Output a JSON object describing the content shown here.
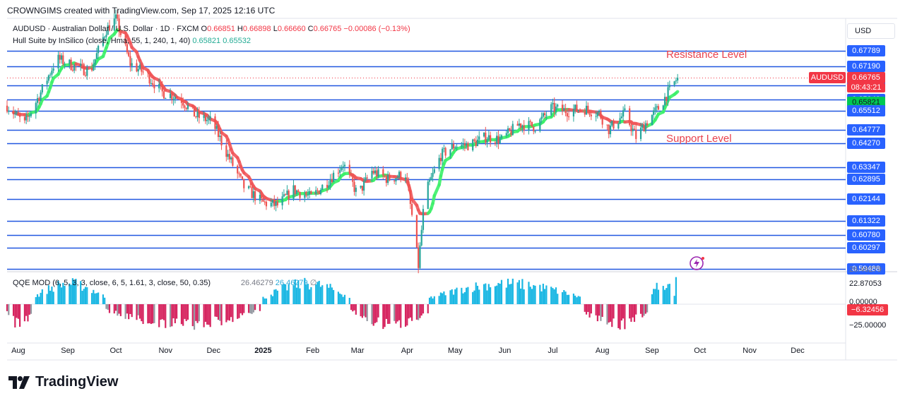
{
  "header": {
    "credit": "CROWNGIMS created with TradingView.com, Sep 17, 2025 12:16 UTC"
  },
  "symbol_line": {
    "name": "AUDUSD · Australian Dollar / U.S. Dollar · 1D · FXCM",
    "o_label": "O",
    "o": "0.66851",
    "h_label": "H",
    "h": "0.66898",
    "l_label": "L",
    "l": "0.66660",
    "c_label": "C",
    "c": "0.66765",
    "change": "−0.00086 (−0.13%)"
  },
  "indicator_line": {
    "name": "Hull Suite by InSilico (close, Hma, 55, 1, 240, 1, 40)",
    "v1": "0.65821",
    "v2": "0.65532"
  },
  "qqe_line": {
    "name": "QQE MOD (6, 5, 3, 3, close, 6, 5, 1.61, 3, close, 50, 0.35)",
    "v1": "26.46279",
    "v2": "26.46279",
    "sym": "∅"
  },
  "overlays": {
    "resistance": "Resistance Level",
    "support": "Support Level"
  },
  "axis": {
    "currency": "USD",
    "symbol_tag": "AUDUSD",
    "last_price": "0.66765",
    "countdown": "08:43:21",
    "qqe_labels": [
      "22.87053",
      "0.00000",
      "−25.00000"
    ],
    "qqe_tag": "−6.32456",
    "qqe_partial": "26.46279"
  },
  "colors": {
    "hline": "#2157e0",
    "bull_candle": "#26a69a",
    "bear_candle": "#ef5350",
    "hull_up": "#3df06a",
    "hull_down": "#f0575a",
    "qqe_blue": "#1ab7e3",
    "qqe_red": "#d6245f",
    "qqe_grey": "#9598a1",
    "annotation": "#e8414d"
  },
  "branding": {
    "logo_text": "TradingView"
  },
  "chart_data": [
    {
      "type": "candlestick",
      "title": "AUDUSD · Australian Dollar / U.S. Dollar · 1D · FXCM",
      "x_ticks": [
        "Aug",
        "Sep",
        "Oct",
        "Nov",
        "Dec",
        "2025",
        "Feb",
        "Mar",
        "Apr",
        "May",
        "Jun",
        "Jul",
        "Aug",
        "Sep",
        "Oct",
        "Nov",
        "Dec"
      ],
      "ylim": [
        0.594,
        0.69
      ],
      "grid": false,
      "horizontal_levels": [
        0.67789,
        0.6719,
        0.66484,
        0.6594,
        0.65512,
        0.64777,
        0.6427,
        0.63347,
        0.62895,
        0.62144,
        0.61322,
        0.6078,
        0.60297,
        0.59488
      ],
      "price_labels": [
        "0.67789",
        "0.67190",
        "0.66484",
        "0.65940",
        "0.65821",
        "0.65532",
        "0.65512",
        "0.64777",
        "0.64270",
        "0.63347",
        "0.62895",
        "0.62144",
        "0.61322",
        "0.60780",
        "0.60297",
        "0.59488"
      ],
      "last_close": 0.66765,
      "close_path": [
        [
          "2024-07-25",
          0.657
        ],
        [
          "2024-08-05",
          0.65
        ],
        [
          "2024-08-15",
          0.662
        ],
        [
          "2024-08-25",
          0.675
        ],
        [
          "2024-09-05",
          0.672
        ],
        [
          "2024-09-15",
          0.67
        ],
        [
          "2024-09-25",
          0.686
        ],
        [
          "2024-10-01",
          0.69
        ],
        [
          "2024-10-10",
          0.673
        ],
        [
          "2024-10-20",
          0.669
        ],
        [
          "2024-10-30",
          0.662
        ],
        [
          "2024-11-10",
          0.66
        ],
        [
          "2024-11-20",
          0.653
        ],
        [
          "2024-11-30",
          0.651
        ],
        [
          "2024-12-10",
          0.638
        ],
        [
          "2024-12-20",
          0.626
        ],
        [
          "2025-01-01",
          0.62
        ],
        [
          "2025-01-10",
          0.619
        ],
        [
          "2025-01-20",
          0.625
        ],
        [
          "2025-01-31",
          0.622
        ],
        [
          "2025-02-10",
          0.628
        ],
        [
          "2025-02-20",
          0.635
        ],
        [
          "2025-03-01",
          0.623
        ],
        [
          "2025-03-10",
          0.632
        ],
        [
          "2025-03-20",
          0.629
        ],
        [
          "2025-03-31",
          0.631
        ],
        [
          "2025-04-04",
          0.615
        ],
        [
          "2025-04-08",
          0.596
        ],
        [
          "2025-04-12",
          0.623
        ],
        [
          "2025-04-22",
          0.638
        ],
        [
          "2025-05-01",
          0.642
        ],
        [
          "2025-05-10",
          0.642
        ],
        [
          "2025-05-20",
          0.645
        ],
        [
          "2025-05-30",
          0.644
        ],
        [
          "2025-06-10",
          0.65
        ],
        [
          "2025-06-20",
          0.649
        ],
        [
          "2025-06-30",
          0.656
        ],
        [
          "2025-07-10",
          0.655
        ],
        [
          "2025-07-20",
          0.656
        ],
        [
          "2025-07-30",
          0.654
        ],
        [
          "2025-08-05",
          0.648
        ],
        [
          "2025-08-15",
          0.654
        ],
        [
          "2025-08-22",
          0.645
        ],
        [
          "2025-08-30",
          0.652
        ],
        [
          "2025-09-05",
          0.656
        ],
        [
          "2025-09-10",
          0.661
        ],
        [
          "2025-09-17",
          0.66765
        ]
      ],
      "hull_suite": {
        "name": "Hull Suite by InSilico (close, Hma, 55, 1, 240, 1, 40)",
        "values": [
          0.65821,
          0.65532
        ]
      }
    },
    {
      "type": "bar",
      "title": "QQE MOD (6, 5, 3, 3, close, 6, 5, 1.61, 3, close, 50, 0.35)",
      "ylim": [
        -30,
        30
      ],
      "ticks": [
        22.87053,
        0,
        -25
      ],
      "last_value": 26.46279,
      "series_colors": [
        "#1ab7e3",
        "#d6245f",
        "#9598a1"
      ],
      "segments": [
        {
          "from": "2024-07-25",
          "to": "2024-08-10",
          "sign": "neg"
        },
        {
          "from": "2024-08-10",
          "to": "2024-09-25",
          "sign": "pos"
        },
        {
          "from": "2024-09-25",
          "to": "2024-12-31",
          "sign": "neg"
        },
        {
          "from": "2025-01-01",
          "to": "2025-02-25",
          "sign": "pos"
        },
        {
          "from": "2025-02-25",
          "to": "2025-04-15",
          "sign": "neg"
        },
        {
          "from": "2025-04-15",
          "to": "2025-07-20",
          "sign": "pos"
        },
        {
          "from": "2025-07-20",
          "to": "2025-08-30",
          "sign": "neg"
        },
        {
          "from": "2025-08-30",
          "to": "2025-09-17",
          "sign": "pos"
        }
      ]
    }
  ]
}
